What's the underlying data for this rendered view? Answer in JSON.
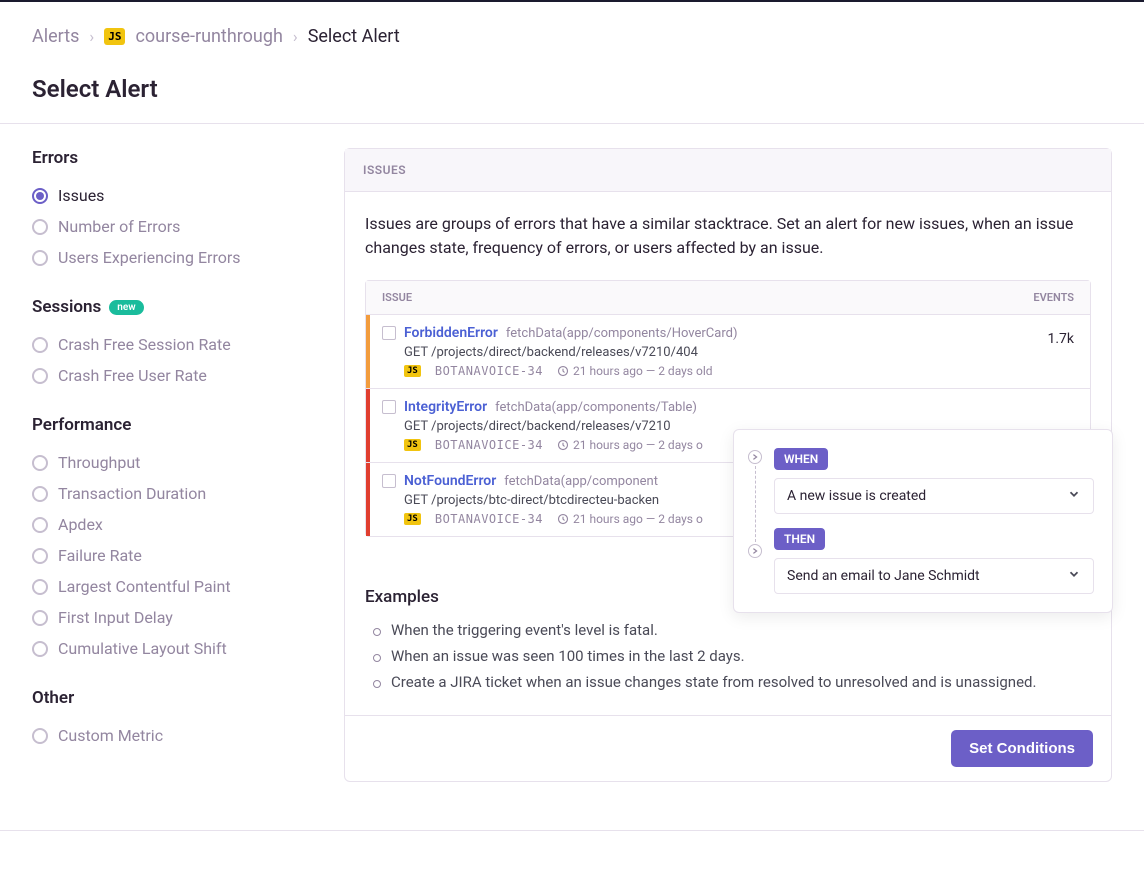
{
  "breadcrumb": {
    "root": "Alerts",
    "project_badge": "JS",
    "project": "course-runthrough",
    "current": "Select Alert"
  },
  "page_title": "Select Alert",
  "sidebar": {
    "groups": [
      {
        "title": "Errors",
        "badge": null,
        "items": [
          {
            "label": "Issues",
            "selected": true
          },
          {
            "label": "Number of Errors",
            "selected": false
          },
          {
            "label": "Users Experiencing Errors",
            "selected": false
          }
        ]
      },
      {
        "title": "Sessions",
        "badge": "new",
        "items": [
          {
            "label": "Crash Free Session Rate",
            "selected": false
          },
          {
            "label": "Crash Free User Rate",
            "selected": false
          }
        ]
      },
      {
        "title": "Performance",
        "badge": null,
        "items": [
          {
            "label": "Throughput",
            "selected": false
          },
          {
            "label": "Transaction Duration",
            "selected": false
          },
          {
            "label": "Apdex",
            "selected": false
          },
          {
            "label": "Failure Rate",
            "selected": false
          },
          {
            "label": "Largest Contentful Paint",
            "selected": false
          },
          {
            "label": "First Input Delay",
            "selected": false
          },
          {
            "label": "Cumulative Layout Shift",
            "selected": false
          }
        ]
      },
      {
        "title": "Other",
        "badge": null,
        "items": [
          {
            "label": "Custom Metric",
            "selected": false
          }
        ]
      }
    ]
  },
  "panel": {
    "header": "ISSUES",
    "description": "Issues are groups of errors that have a similar stacktrace. Set an alert for new issues, when an issue changes state, frequency of errors, or users affected by an issue.",
    "table": {
      "col_issue": "ISSUE",
      "col_events": "EVENTS",
      "rows": [
        {
          "bar": "orange",
          "name": "ForbiddenError",
          "source": "fetchData(app/components/HoverCard)",
          "path": "GET /projects/direct/backend/releases/v7210/404",
          "proj_badge": "JS",
          "proj": "BOTANAVOICE-34",
          "time": "21 hours ago — 2 days old",
          "events": "1.7k"
        },
        {
          "bar": "red",
          "name": "IntegrityError",
          "source": "fetchData(app/components/Table)",
          "path": "GET /projects/direct/backend/releases/v7210",
          "proj_badge": "JS",
          "proj": "BOTANAVOICE-34",
          "time": "21 hours ago — 2 days o",
          "events": ""
        },
        {
          "bar": "red",
          "name": "NotFoundError",
          "source": "fetchData(app/component",
          "path": "GET /projects/btc-direct/btcdirecteu-backen",
          "proj_badge": "JS",
          "proj": "BOTANAVOICE-34",
          "time": "21 hours ago — 2 days o",
          "events": ""
        }
      ]
    },
    "overlay": {
      "when_tag": "WHEN",
      "when_value": "A new issue is created",
      "then_tag": "THEN",
      "then_value": "Send an email to Jane Schmidt"
    },
    "examples_title": "Examples",
    "examples": [
      "When the triggering event's level is fatal.",
      "When an issue was seen 100 times in the last 2 days.",
      "Create a JIRA ticket when an issue changes state from resolved to unresolved and is unassigned."
    ],
    "button": "Set Conditions"
  }
}
